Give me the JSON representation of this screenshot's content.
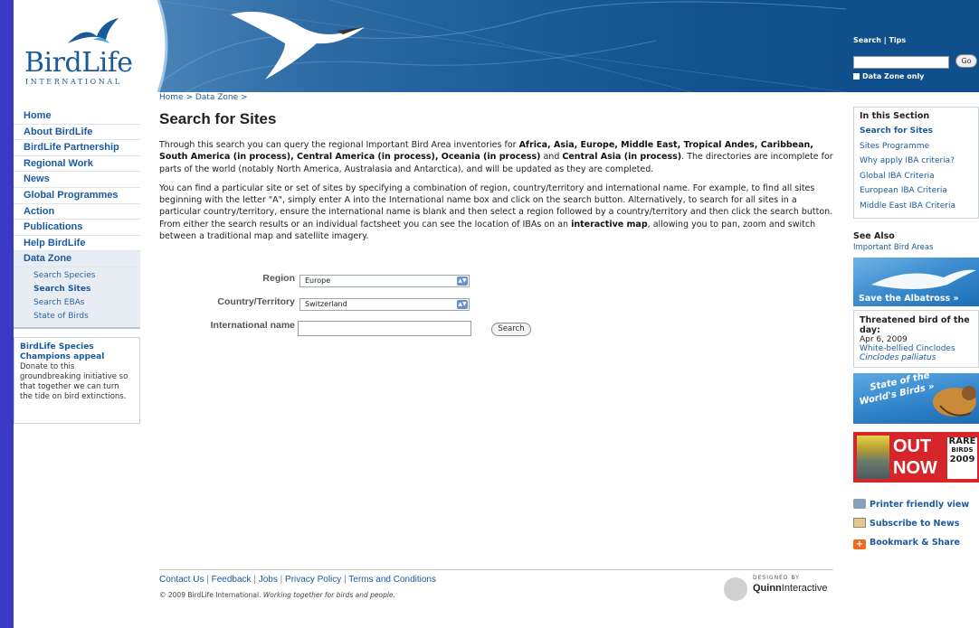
{
  "header": {
    "logo_text": "BirdLife",
    "logo_sub": "INTERNATIONAL",
    "search_link": "Search",
    "tips_link": "Tips",
    "go_label": "Go",
    "data_zone_only": "Data Zone only"
  },
  "breadcrumb": "Home > Data Zone >",
  "nav": {
    "items": [
      "Home",
      "About BirdLife",
      "BirdLife Partnership",
      "Regional Work",
      "News",
      "Global Programmes",
      "Action",
      "Publications",
      "Help BirdLife",
      "Data Zone"
    ],
    "sub_items": [
      "Search Species",
      "Search Sites",
      "Search EBAs",
      "State of Birds"
    ]
  },
  "appeal": {
    "title": "BirdLife Species Champions appeal",
    "body": "Donate to this groundbreaking initiative so that together we can turn the tide on bird extinctions."
  },
  "main": {
    "title": "Search for Sites",
    "p1_a": "Through this search you can query the regional Important Bird Area inventories for ",
    "p1_regions": "Africa, Asia, Europe, Middle East, Tropical Andes, Caribbean, South America (in process), Central America (in process), Oceania (in process)",
    "p1_b": " and ",
    "p1_ca": "Central Asia (in process)",
    "p1_c": ". The directories are incomplete for parts of the world (notably North America, Australasia and Antarctica), and will be updated as they are completed.",
    "p2_a": "You can find a particular site or set of sites by specifying a combination of region, country/territory and international name. For example, to find all sites beginning with the letter \"A\", simply enter A into the International name box and click on the search button. Alternatively, to search for all sites in a particular country/territory, ensure the international name is blank and then select a region followed by a country/territory and then click the search button. From either the search results or an individual factsheet you can see the location of IBAs on an ",
    "p2_map": "interactive map",
    "p2_b": ", allowing you to pan, zoom and switch between a traditional map and satellite imagery."
  },
  "form": {
    "region_label": "Region",
    "region_value": "Europe",
    "country_label": "Country/Territory",
    "country_value": "Switzerland",
    "name_label": "International name",
    "name_value": "",
    "search_button": "Search"
  },
  "footer": {
    "links": [
      "Contact Us",
      "Feedback",
      "Jobs",
      "Privacy Policy",
      "Terms and Conditions"
    ],
    "copyright": "© 2009 BirdLife International.",
    "tagline": "Working together for birds and people.",
    "designed_by": "DESIGNED BY",
    "designer_bold": "Quinn",
    "designer_rest": "Interactive"
  },
  "right": {
    "section_title": "In this Section",
    "section_links": [
      "Search for Sites",
      "Sites Programme",
      "Why apply IBA criteria?",
      "Global IBA Criteria",
      "European IBA Criteria",
      "Middle East IBA Criteria"
    ],
    "see_also_title": "See Also",
    "see_also_link": "Important Bird Areas",
    "albatross_label": "Save the Albatross »",
    "threatened_title": "Threatened bird of the day:",
    "threatened_date": "Apr 6, 2009",
    "threatened_common": "White-bellied Cinclodes",
    "threatened_latin": "Cinclodes palliatus",
    "sowb_line1": "State of the",
    "sowb_line2": "World's Birds »",
    "rare_out": "OUT",
    "rare_now": "NOW",
    "rare_a": "RARE",
    "rare_b": "BIRDS",
    "rare_c": "2009",
    "actions": [
      "Printer friendly view",
      "Subscribe to News",
      "Bookmark & Share"
    ]
  },
  "colors": {
    "background": "#3a39c8",
    "header_blue": "#0f4f8c",
    "link_blue": "#1a5aa0",
    "rare_red": "#d7262b"
  }
}
